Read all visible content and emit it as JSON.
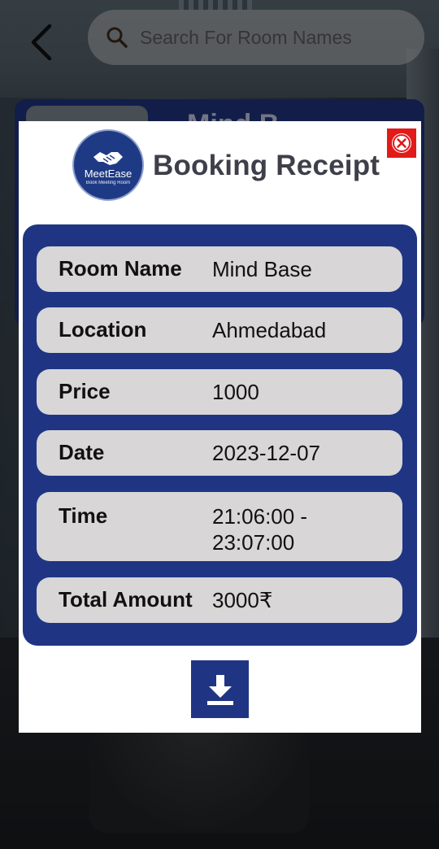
{
  "top_bar": {
    "back_icon": "chevron-left-icon",
    "search": {
      "icon": "search-icon",
      "placeholder": "Search For Room Names",
      "value": ""
    }
  },
  "background_card": {
    "title": "Mind B"
  },
  "modal": {
    "logo": {
      "brand": "MeetEase",
      "tagline": "Book Meeting Room",
      "icon": "handshake-icon"
    },
    "title": "Booking Receipt",
    "close_icon": "close-icon",
    "rows": [
      {
        "label": "Room Name",
        "value": "Mind Base"
      },
      {
        "label": "Location",
        "value": "Ahmedabad"
      },
      {
        "label": "Price",
        "value": "1000"
      },
      {
        "label": "Date",
        "value": "2023-12-07"
      },
      {
        "label": "Time",
        "value": "21:06:00 -\n23:07:00"
      },
      {
        "label": "Total Amount",
        "value": "3000₹"
      }
    ],
    "download_icon": "download-icon"
  },
  "colors": {
    "primary": "#1f3584",
    "row_bg": "#d8d6d6",
    "close": "#e21a1a",
    "title_text": "#3f3f4a"
  }
}
